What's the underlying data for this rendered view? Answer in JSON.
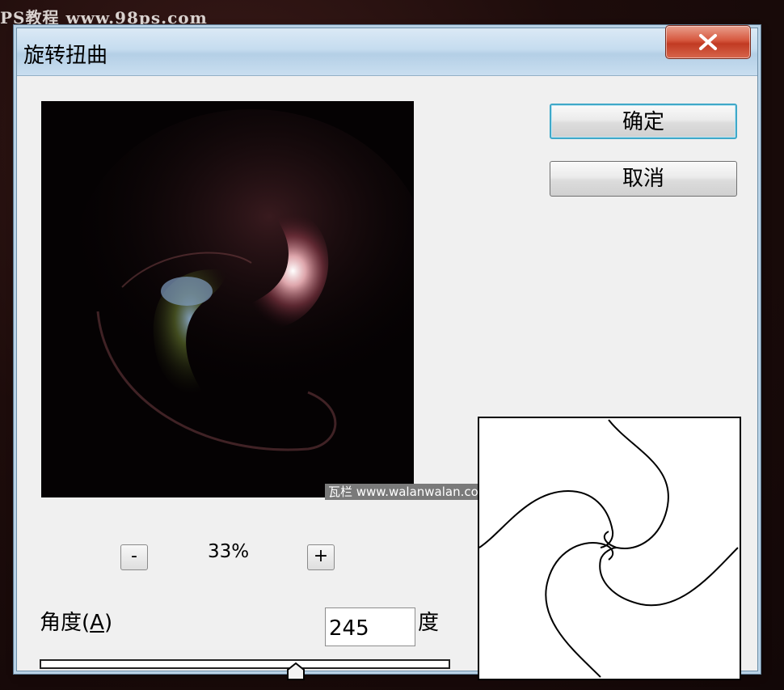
{
  "background": {
    "site_text": "PS教程 www.98ps.com"
  },
  "dialog": {
    "title": "旋转扭曲",
    "close_glyph": "X"
  },
  "buttons": {
    "ok_label": "确定",
    "cancel_label": "取消"
  },
  "zoom": {
    "minus_label": "-",
    "plus_label": "+",
    "value": "33%"
  },
  "angle": {
    "label": "角度(",
    "mnemonic": "A",
    "label_end": ")",
    "value": "245",
    "unit": "度",
    "slider_fraction": 0.63
  },
  "watermark": {
    "text": "瓦栏 www.walanwalan.com"
  },
  "icons": {
    "close": "close-icon",
    "slider_thumb": "slider-thumb-icon"
  },
  "colors": {
    "dialog_bg": "#f0f0f0",
    "title_bar": "#c5dcef",
    "close_red": "#c13a22",
    "default_button_border": "#3fa8c8"
  }
}
